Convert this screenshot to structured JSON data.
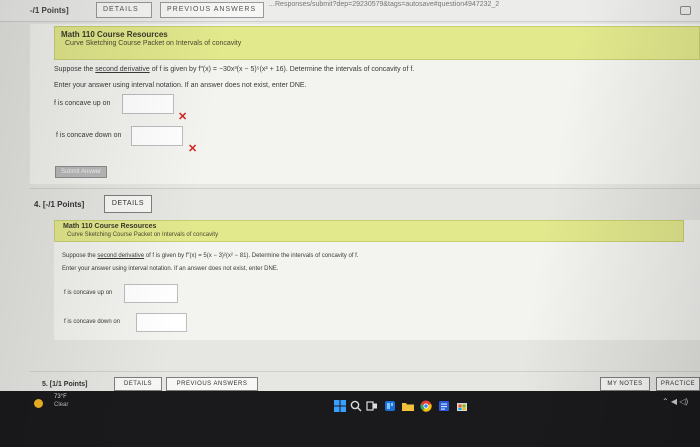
{
  "topbar": {
    "points": "-/1 Points]",
    "details": "DETAILS",
    "previous_answers": "PREVIOUS ANSWERS",
    "url": "…Responses/submit?dep=29230579&tags=autosave#question4947232_2"
  },
  "q3": {
    "banner_title": "Math 110 Course Resources",
    "banner_subtitle": "Curve Sketching Course Packet on Intervals of concavity",
    "prompt_pre": "Suppose the ",
    "prompt_link": "second derivative",
    "prompt_post": " of f is given by f″(x) = −30x³(x − 5)⁵(x² + 16). Determine the intervals of concavity of f.",
    "instructions": "Enter your answer using interval notation. If an answer does not exist, enter DNE.",
    "concave_up_label": "f is concave up on",
    "concave_up_value": "",
    "concave_down_label": "f is concave down on",
    "concave_down_value": "",
    "incorrect_mark": "✕",
    "submit_label": "Submit Answer"
  },
  "q4": {
    "header": "4.  [-/1 Points]",
    "details": "DETAILS",
    "banner_title": "Math 110 Course Resources",
    "banner_subtitle": "Curve Sketching Course Packet on Intervals of concavity",
    "prompt_pre": "Suppose the ",
    "prompt_link": "second derivative",
    "prompt_post": " of f is given by f″(x) = 5(x − 3)²(x² − 81). Determine the intervals of concavity of f.",
    "instructions": "Enter your answer using interval notation. If an answer does not exist, enter DNE.",
    "concave_up_label": "f is concave up on",
    "concave_up_value": "",
    "concave_down_label": "f is concave down on",
    "concave_down_value": ""
  },
  "q5": {
    "header": "5.  [1/1 Points]",
    "details": "DETAILS",
    "previous_answers": "PREVIOUS ANSWERS",
    "my_notes": "MY NOTES",
    "practice": "PRACTICE"
  },
  "taskbar": {
    "temperature": "73°F",
    "condition": "Clear",
    "tray": "⌃ ◀ ◁)"
  },
  "colors": {
    "banner": "#e2e88c",
    "incorrect": "#d12222",
    "taskbar": "#1a1a1d"
  }
}
